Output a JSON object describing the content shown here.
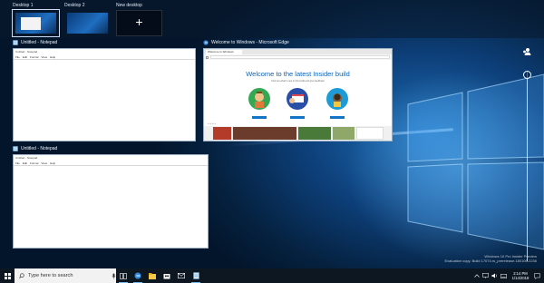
{
  "desktops": [
    {
      "label": "Desktop 1",
      "active": true
    },
    {
      "label": "Desktop 2",
      "active": false
    }
  ],
  "new_desktop": {
    "label": "New desktop",
    "icon": "plus-icon"
  },
  "windows": {
    "notepad1": {
      "title": "Untitled - Notepad",
      "inner_title": "Untitled - Notepad",
      "menu": [
        "File",
        "Edit",
        "Format",
        "View",
        "Help"
      ]
    },
    "edge": {
      "title": "Welcome to Windows - Microsoft Edge",
      "tab": "Welcome to Windows",
      "headline": "Welcome to the latest Insider build",
      "subtitle": "Find out what's new in this build and give feedback"
    },
    "notepad2": {
      "title": "Untitled - Notepad",
      "inner_title": "Untitled - Notepad",
      "menu": [
        "File",
        "Edit",
        "Format",
        "View",
        "Help"
      ]
    }
  },
  "watermark": {
    "line1": "Windows 10 Pro Insider Preview",
    "line2": "Evaluation copy. Build 17074.rs_prerelease.180106-2236"
  },
  "taskbar": {
    "search_placeholder": "Type here to search",
    "clock_time": "2:14 PM",
    "clock_date": "1/14/2018",
    "apps": [
      "task-view-icon",
      "edge-icon",
      "file-explorer-icon",
      "store-icon",
      "mail-icon",
      "notepad-icon"
    ]
  },
  "colors": {
    "accent": "#0078d7",
    "taskbar": "#0c1722",
    "edge_blue": "#0b63b8"
  }
}
